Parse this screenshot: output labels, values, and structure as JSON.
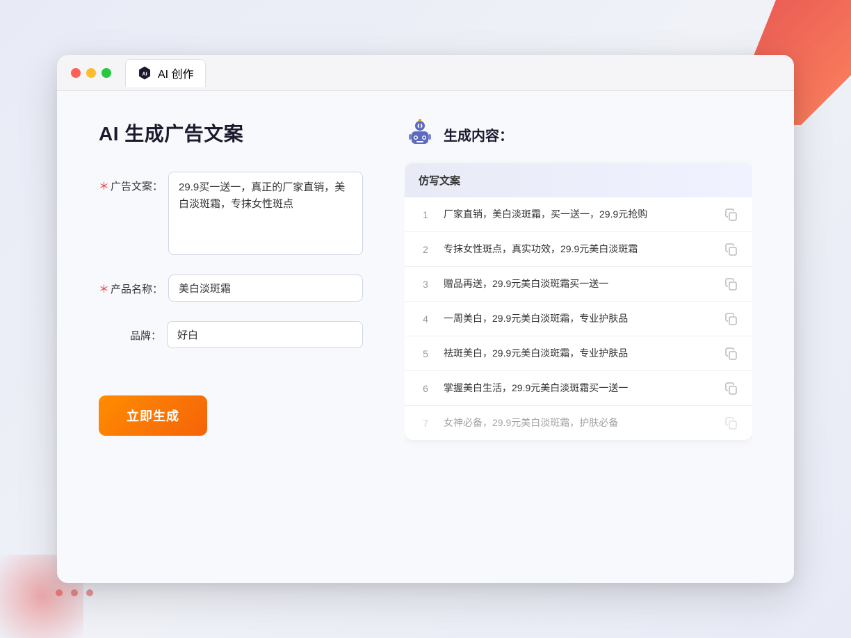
{
  "window": {
    "tab_label": "AI 创作",
    "traffic_lights": [
      "red",
      "yellow",
      "green"
    ]
  },
  "page": {
    "title": "AI 生成广告文案"
  },
  "form": {
    "ad_copy_label": "广告文案：",
    "ad_copy_required": "＊",
    "ad_copy_value": "29.9买一送一，真正的厂家直销，美白淡斑霜，专抹女性斑点",
    "product_name_label": "产品名称：",
    "product_name_required": "＊",
    "product_name_value": "美白淡斑霜",
    "brand_label": "品牌：",
    "brand_value": "好白",
    "generate_btn": "立即生成"
  },
  "result": {
    "header_label": "生成内容：",
    "table_col": "仿写文案",
    "items": [
      {
        "num": "1",
        "text": "厂家直销，美白淡斑霜，买一送一，29.9元抢购",
        "faded": false
      },
      {
        "num": "2",
        "text": "专抹女性斑点，真实功效，29.9元美白淡斑霜",
        "faded": false
      },
      {
        "num": "3",
        "text": "赠品再送，29.9元美白淡斑霜买一送一",
        "faded": false
      },
      {
        "num": "4",
        "text": "一周美白，29.9元美白淡斑霜，专业护肤品",
        "faded": false
      },
      {
        "num": "5",
        "text": "祛斑美白，29.9元美白淡斑霜，专业护肤品",
        "faded": false
      },
      {
        "num": "6",
        "text": "掌握美白生活，29.9元美白淡斑霜买一送一",
        "faded": false
      },
      {
        "num": "7",
        "text": "女神必备，29.9元美白淡斑霜，护肤必备",
        "faded": true
      }
    ]
  },
  "colors": {
    "required_star": "#e53935",
    "generate_btn_start": "#ff8c00",
    "generate_btn_end": "#f5630a",
    "accent": "#5c6bc0"
  }
}
